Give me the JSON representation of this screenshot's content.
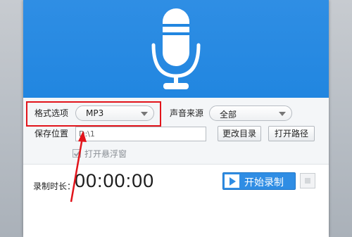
{
  "settings": {
    "format_label": "格式选项",
    "format_value": "MP3",
    "source_label": "声音来源",
    "source_value": "全部",
    "save_label": "保存位置",
    "save_path": "D:\\1",
    "change_dir_label": "更改目录",
    "open_path_label": "打开路径",
    "floating_window_label": "打开悬浮窗"
  },
  "footer": {
    "duration_label": "录制时长：",
    "duration_value": "00:00:00",
    "start_label": "开始录制"
  },
  "colors": {
    "header_blue": "#2186e0",
    "annotation_red": "#e2141b"
  },
  "icons": [
    "microphone-icon",
    "play-icon",
    "stop-icon",
    "dropdown-caret-icon",
    "checkbox-icon"
  ]
}
